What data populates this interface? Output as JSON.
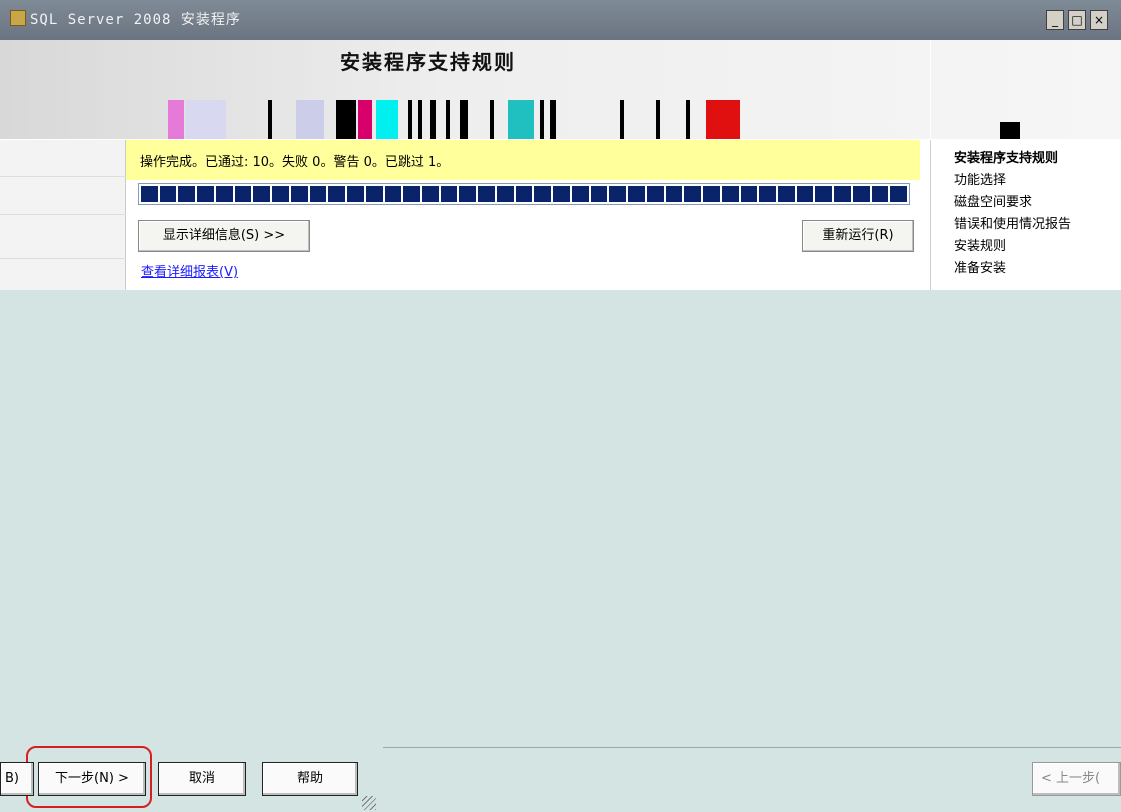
{
  "window": {
    "title": "SQL Server 2008 安装程序",
    "min_label": "_",
    "max_label": "□",
    "close_label": "×"
  },
  "banner": {
    "title": "安装程序支持规则"
  },
  "status": {
    "text": "操作完成。已通过: 10。失败 0。警告 0。已跳过 1。"
  },
  "progress": {
    "fraction": 1.0
  },
  "buttons": {
    "details": "显示详细信息(S) >>",
    "rerun": "重新运行(R)",
    "next": "下一步(N) >",
    "cancel": "取消",
    "help": "帮助",
    "prev": "< 上一步(",
    "cut_left": "B)"
  },
  "links": {
    "report": "查看详细报表(V)"
  },
  "steps": [
    {
      "label": "安装程序支持规则",
      "current": true
    },
    {
      "label": "功能选择",
      "current": false
    },
    {
      "label": "磁盘空间要求",
      "current": false
    },
    {
      "label": "错误和使用情况报告",
      "current": false
    },
    {
      "label": "安装规则",
      "current": false
    },
    {
      "label": "准备安装",
      "current": false
    }
  ],
  "colors": {
    "status_bg": "#ffff9b",
    "progress_fill": "#0a246a",
    "content_bg": "#d3e4e3",
    "highlight": "#d42020",
    "link": "#1a1aff"
  }
}
